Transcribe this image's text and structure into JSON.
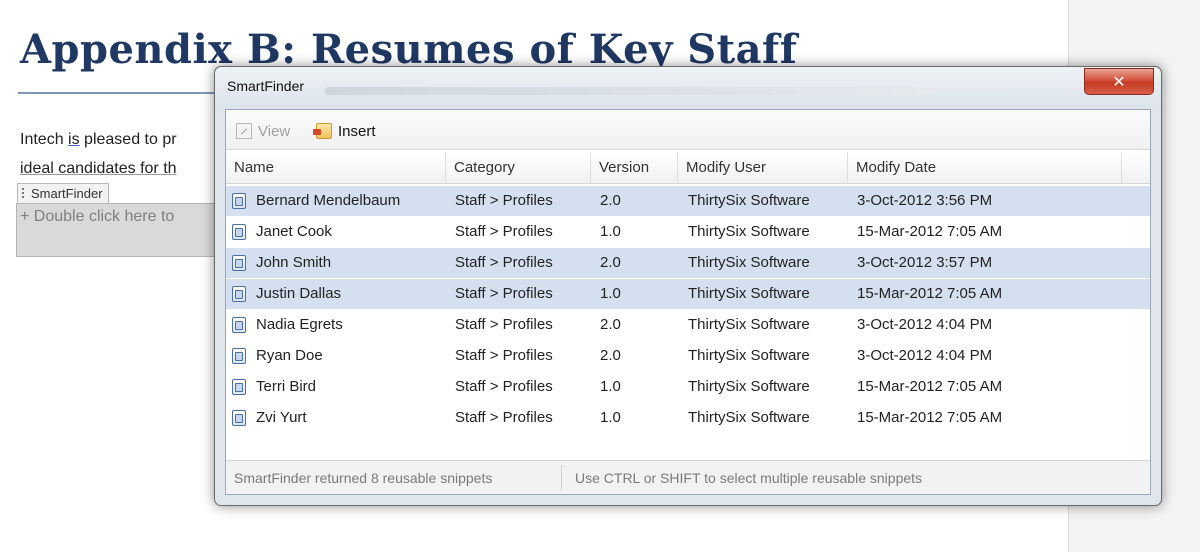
{
  "document": {
    "heading": "Appendix B:  Resumes of Key Staff",
    "line1_prefix": "Intech ",
    "line1_is": "is",
    "line1_suffix": " pleased to pr",
    "line2": "ideal candidates for th",
    "content_control_tag": "SmartFinder",
    "content_control_placeholder": "+ Double click here to"
  },
  "dialog": {
    "title": "SmartFinder",
    "close_glyph": "✕",
    "toolbar": {
      "view_label": "View",
      "insert_label": "Insert"
    },
    "columns": {
      "name": "Name",
      "category": "Category",
      "version": "Version",
      "modify_user": "Modify User",
      "modify_date": "Modify Date"
    },
    "rows": [
      {
        "name": "Bernard Mendelbaum",
        "category": "Staff > Profiles",
        "version": "2.0",
        "user": "ThirtySix Software",
        "date": "3-Oct-2012 3:56 PM",
        "selected": true
      },
      {
        "name": "Janet Cook",
        "category": "Staff > Profiles",
        "version": "1.0",
        "user": "ThirtySix Software",
        "date": "15-Mar-2012 7:05 AM",
        "selected": false
      },
      {
        "name": "John Smith",
        "category": "Staff > Profiles",
        "version": "2.0",
        "user": "ThirtySix Software",
        "date": "3-Oct-2012 3:57 PM",
        "selected": true
      },
      {
        "name": "Justin Dallas",
        "category": "Staff > Profiles",
        "version": "1.0",
        "user": "ThirtySix Software",
        "date": "15-Mar-2012 7:05 AM",
        "selected": true
      },
      {
        "name": "Nadia Egrets",
        "category": "Staff > Profiles",
        "version": "2.0",
        "user": "ThirtySix Software",
        "date": "3-Oct-2012 4:04 PM",
        "selected": false
      },
      {
        "name": "Ryan Doe",
        "category": "Staff > Profiles",
        "version": "2.0",
        "user": "ThirtySix Software",
        "date": "3-Oct-2012 4:04 PM",
        "selected": false
      },
      {
        "name": "Terri Bird",
        "category": "Staff > Profiles",
        "version": "1.0",
        "user": "ThirtySix Software",
        "date": "15-Mar-2012 7:05 AM",
        "selected": false
      },
      {
        "name": "Zvi Yurt",
        "category": "Staff > Profiles",
        "version": "1.0",
        "user": "ThirtySix Software",
        "date": "15-Mar-2012 7:05 AM",
        "selected": false
      }
    ],
    "status": {
      "left": "SmartFinder returned 8 reusable snippets",
      "right": "Use CTRL or SHIFT to select multiple reusable snippets"
    },
    "colors": {
      "selected_row": "#d4e0ef",
      "close_button": "#c33a22",
      "heading": "#1f3864"
    },
    "icons": {
      "view": "view-icon",
      "insert": "insert-icon",
      "row": "snippet-icon",
      "close": "close-icon"
    }
  }
}
